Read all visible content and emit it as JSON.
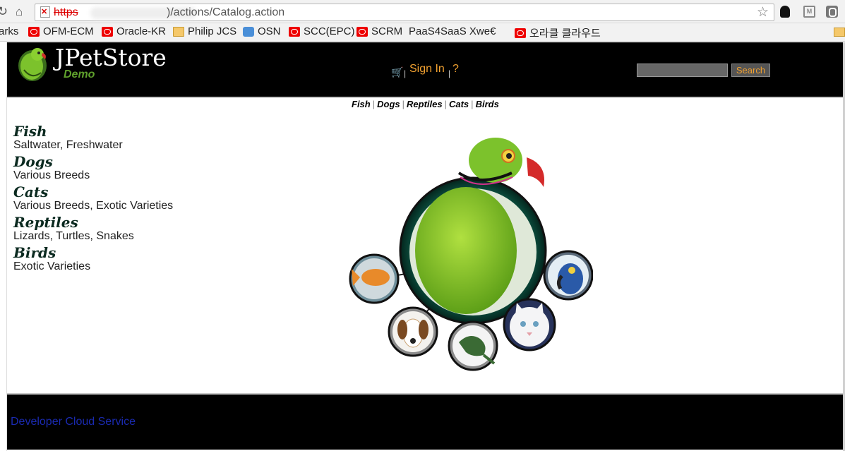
{
  "browser": {
    "url_protocol": "https",
    "url_path": "://141.144.99.100/actions/Catalog.action",
    "url_visible_tail": ")/actions/Catalog.action"
  },
  "bookmarks": [
    {
      "label": "arks",
      "icon": "none"
    },
    {
      "label": "OFM-ECM",
      "icon": "oracle-icon"
    },
    {
      "label": "Oracle-KR",
      "icon": "oracle-icon"
    },
    {
      "label": "Philip JCS",
      "icon": "folder-icon"
    },
    {
      "label": "OSN",
      "icon": "chat-icon"
    },
    {
      "label": "SCC(EPC)",
      "icon": "oracle-icon"
    },
    {
      "label": "SCRM",
      "icon": "oracle-icon"
    },
    {
      "label": "PaaS4SaaS Xwe€",
      "icon": "page-icon"
    },
    {
      "label": "오라클 클라우드",
      "icon": "oracle-icon"
    }
  ],
  "header": {
    "title": "JPetStore",
    "subtitle": "Demo",
    "sign_in": "Sign In",
    "help": "?",
    "search_button": "Search",
    "search_value": ""
  },
  "quicklinks": [
    "Fish",
    "Dogs",
    "Reptiles",
    "Cats",
    "Birds"
  ],
  "categories": [
    {
      "name": "Fish",
      "desc": "Saltwater, Freshwater"
    },
    {
      "name": "Dogs",
      "desc": "Various Breeds"
    },
    {
      "name": "Cats",
      "desc": "Various Breeds, Exotic Varieties"
    },
    {
      "name": "Reptiles",
      "desc": "Lizards, Turtles, Snakes"
    },
    {
      "name": "Birds",
      "desc": "Exotic Varieties"
    }
  ],
  "footer": {
    "link": "Developer Cloud Service"
  },
  "colors": {
    "header_bg": "#000000",
    "accent_orange": "#f0a030",
    "demo_green": "#5fa02c",
    "footer_link": "#1a2ab0"
  }
}
